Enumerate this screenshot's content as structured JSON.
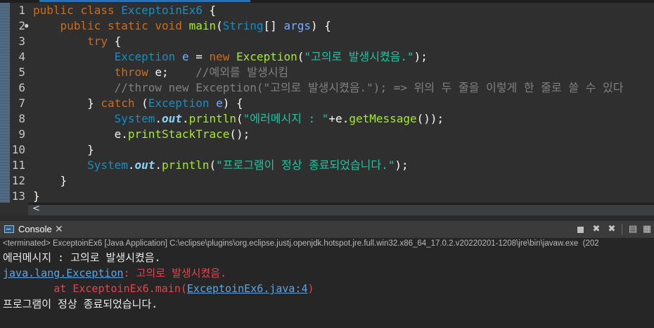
{
  "editor": {
    "lines": [
      {
        "n": "1",
        "fold": "",
        "tokens": [
          {
            "c": "kw",
            "t": "public"
          },
          {
            "c": "pl",
            "t": " "
          },
          {
            "c": "kw",
            "t": "class"
          },
          {
            "c": "pl",
            "t": " "
          },
          {
            "c": "cls",
            "t": "ExceptoinEx6"
          },
          {
            "c": "pl",
            "t": " {"
          }
        ]
      },
      {
        "n": "2",
        "fold": "●",
        "tokens": [
          {
            "c": "pl",
            "t": "    "
          },
          {
            "c": "kw",
            "t": "public"
          },
          {
            "c": "pl",
            "t": " "
          },
          {
            "c": "kw",
            "t": "static"
          },
          {
            "c": "pl",
            "t": " "
          },
          {
            "c": "kw",
            "t": "void"
          },
          {
            "c": "pl",
            "t": " "
          },
          {
            "c": "fn",
            "t": "main"
          },
          {
            "c": "pl",
            "t": "("
          },
          {
            "c": "ty",
            "t": "String"
          },
          {
            "c": "pl",
            "t": "[] "
          },
          {
            "c": "var",
            "t": "args"
          },
          {
            "c": "pl",
            "t": ") {"
          }
        ]
      },
      {
        "n": "3",
        "fold": "",
        "tokens": [
          {
            "c": "pl",
            "t": "        "
          },
          {
            "c": "kw",
            "t": "try"
          },
          {
            "c": "pl",
            "t": " {"
          }
        ]
      },
      {
        "n": "4",
        "fold": "",
        "tokens": [
          {
            "c": "pl",
            "t": "            "
          },
          {
            "c": "ty",
            "t": "Exception"
          },
          {
            "c": "pl",
            "t": " "
          },
          {
            "c": "var",
            "t": "e"
          },
          {
            "c": "pl",
            "t": " = "
          },
          {
            "c": "kw",
            "t": "new"
          },
          {
            "c": "pl",
            "t": " "
          },
          {
            "c": "fn",
            "t": "Exception"
          },
          {
            "c": "pl",
            "t": "("
          },
          {
            "c": "str",
            "t": "\"고의로 발생시켰음.\""
          },
          {
            "c": "pl",
            "t": ");"
          }
        ]
      },
      {
        "n": "5",
        "fold": "",
        "tokens": [
          {
            "c": "pl",
            "t": "            "
          },
          {
            "c": "kw",
            "t": "throw"
          },
          {
            "c": "pl",
            "t": " e;    "
          },
          {
            "c": "cm",
            "t": "//예외를 발생시킴"
          }
        ]
      },
      {
        "n": "6",
        "fold": "",
        "tokens": [
          {
            "c": "pl",
            "t": "            "
          },
          {
            "c": "cm",
            "t": "//throw new Exception(\"고의로 발생시켰음.\"); => 위의 두 줄을 이렇게 한 줄로 쓸 수 있다"
          }
        ]
      },
      {
        "n": "7",
        "fold": "",
        "tokens": [
          {
            "c": "pl",
            "t": "        } "
          },
          {
            "c": "kw",
            "t": "catch"
          },
          {
            "c": "pl",
            "t": " ("
          },
          {
            "c": "ty",
            "t": "Exception"
          },
          {
            "c": "pl",
            "t": " "
          },
          {
            "c": "var",
            "t": "e"
          },
          {
            "c": "pl",
            "t": ") {"
          }
        ]
      },
      {
        "n": "8",
        "fold": "",
        "tokens": [
          {
            "c": "pl",
            "t": "            "
          },
          {
            "c": "ty",
            "t": "System"
          },
          {
            "c": "pl",
            "t": "."
          },
          {
            "c": "fld",
            "t": "out"
          },
          {
            "c": "pl",
            "t": "."
          },
          {
            "c": "fn",
            "t": "println"
          },
          {
            "c": "pl",
            "t": "("
          },
          {
            "c": "str",
            "t": "\"에러메시지 : \""
          },
          {
            "c": "pl",
            "t": "+e."
          },
          {
            "c": "fn",
            "t": "getMessage"
          },
          {
            "c": "pl",
            "t": "());"
          }
        ]
      },
      {
        "n": "9",
        "fold": "",
        "tokens": [
          {
            "c": "pl",
            "t": "            e."
          },
          {
            "c": "fn",
            "t": "printStackTrace"
          },
          {
            "c": "pl",
            "t": "();"
          }
        ]
      },
      {
        "n": "10",
        "fold": "",
        "tokens": [
          {
            "c": "pl",
            "t": "        }"
          }
        ]
      },
      {
        "n": "11",
        "fold": "",
        "tokens": [
          {
            "c": "pl",
            "t": "        "
          },
          {
            "c": "ty",
            "t": "System"
          },
          {
            "c": "pl",
            "t": "."
          },
          {
            "c": "fld",
            "t": "out"
          },
          {
            "c": "pl",
            "t": "."
          },
          {
            "c": "fn",
            "t": "println"
          },
          {
            "c": "pl",
            "t": "("
          },
          {
            "c": "str",
            "t": "\"프로그램이 정상 종료되었습니다.\""
          },
          {
            "c": "pl",
            "t": ");"
          }
        ]
      },
      {
        "n": "12",
        "fold": "",
        "tokens": [
          {
            "c": "pl",
            "t": "    }"
          }
        ]
      },
      {
        "n": "13",
        "fold": "",
        "tokens": [
          {
            "c": "pl",
            "t": "}"
          }
        ]
      }
    ],
    "scroll_arrow": "<"
  },
  "console": {
    "tab_label": "Console",
    "close_glyph": "✕",
    "terminated_text": "<terminated> ExceptoinEx6 [Java Application] C:\\eclipse\\plugins\\org.eclipse.justj.openjdk.hotspot.jre.full.win32.x86_64_17.0.2.v20220201-1208\\jre\\bin\\javaw.exe  (202",
    "output": {
      "line1": "에러메시지 : 고의로 발생시켰음.",
      "line2_link": "java.lang.Exception",
      "line2_rest": ": 고의로 발생시켰음.",
      "line3_prefix": "        at ExceptoinEx6.main(",
      "line3_link": "ExceptoinEx6.java:4",
      "line3_suffix": ")",
      "line4": "프로그램이 정상 종료되었습니다."
    }
  },
  "colors": {
    "keyword": "#cc6c1d",
    "method": "#a7ec21",
    "type": "#1290c3",
    "string": "#17c6a3",
    "comment": "#808080",
    "error": "#e0464d",
    "link": "#5ea5e6"
  }
}
